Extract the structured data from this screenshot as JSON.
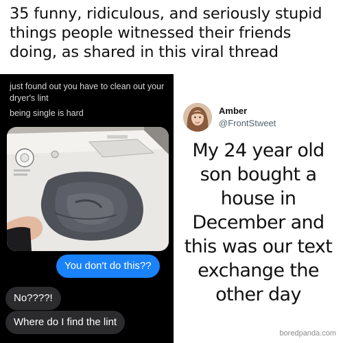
{
  "headline": {
    "text": "35 funny, ridiculous, and seriously stupid things people witnessed their friends doing, as shared in this viral thread"
  },
  "chat": {
    "caption_line1": "just found out you have to clean out your dryer's lint",
    "caption_line2": "being single is hard",
    "photo_icon": "dryer-lint-photo",
    "messages": [
      {
        "side": "sent",
        "text": "You don't do this??"
      },
      {
        "side": "received",
        "text": "No????!"
      },
      {
        "side": "received",
        "text": "Where do I find the lint"
      }
    ],
    "colors": {
      "background": "#000000",
      "sent_bubble": "#1a82fb",
      "received_bubble": "#2b2b2d"
    }
  },
  "tweet": {
    "author_name": "Amber",
    "author_handle": "@FrontStweet",
    "avatar_icon": "profile-photo",
    "body": "My 24 year old son bought a house in December and this was our text exchange the other day"
  },
  "watermark": "boredpanda.com"
}
